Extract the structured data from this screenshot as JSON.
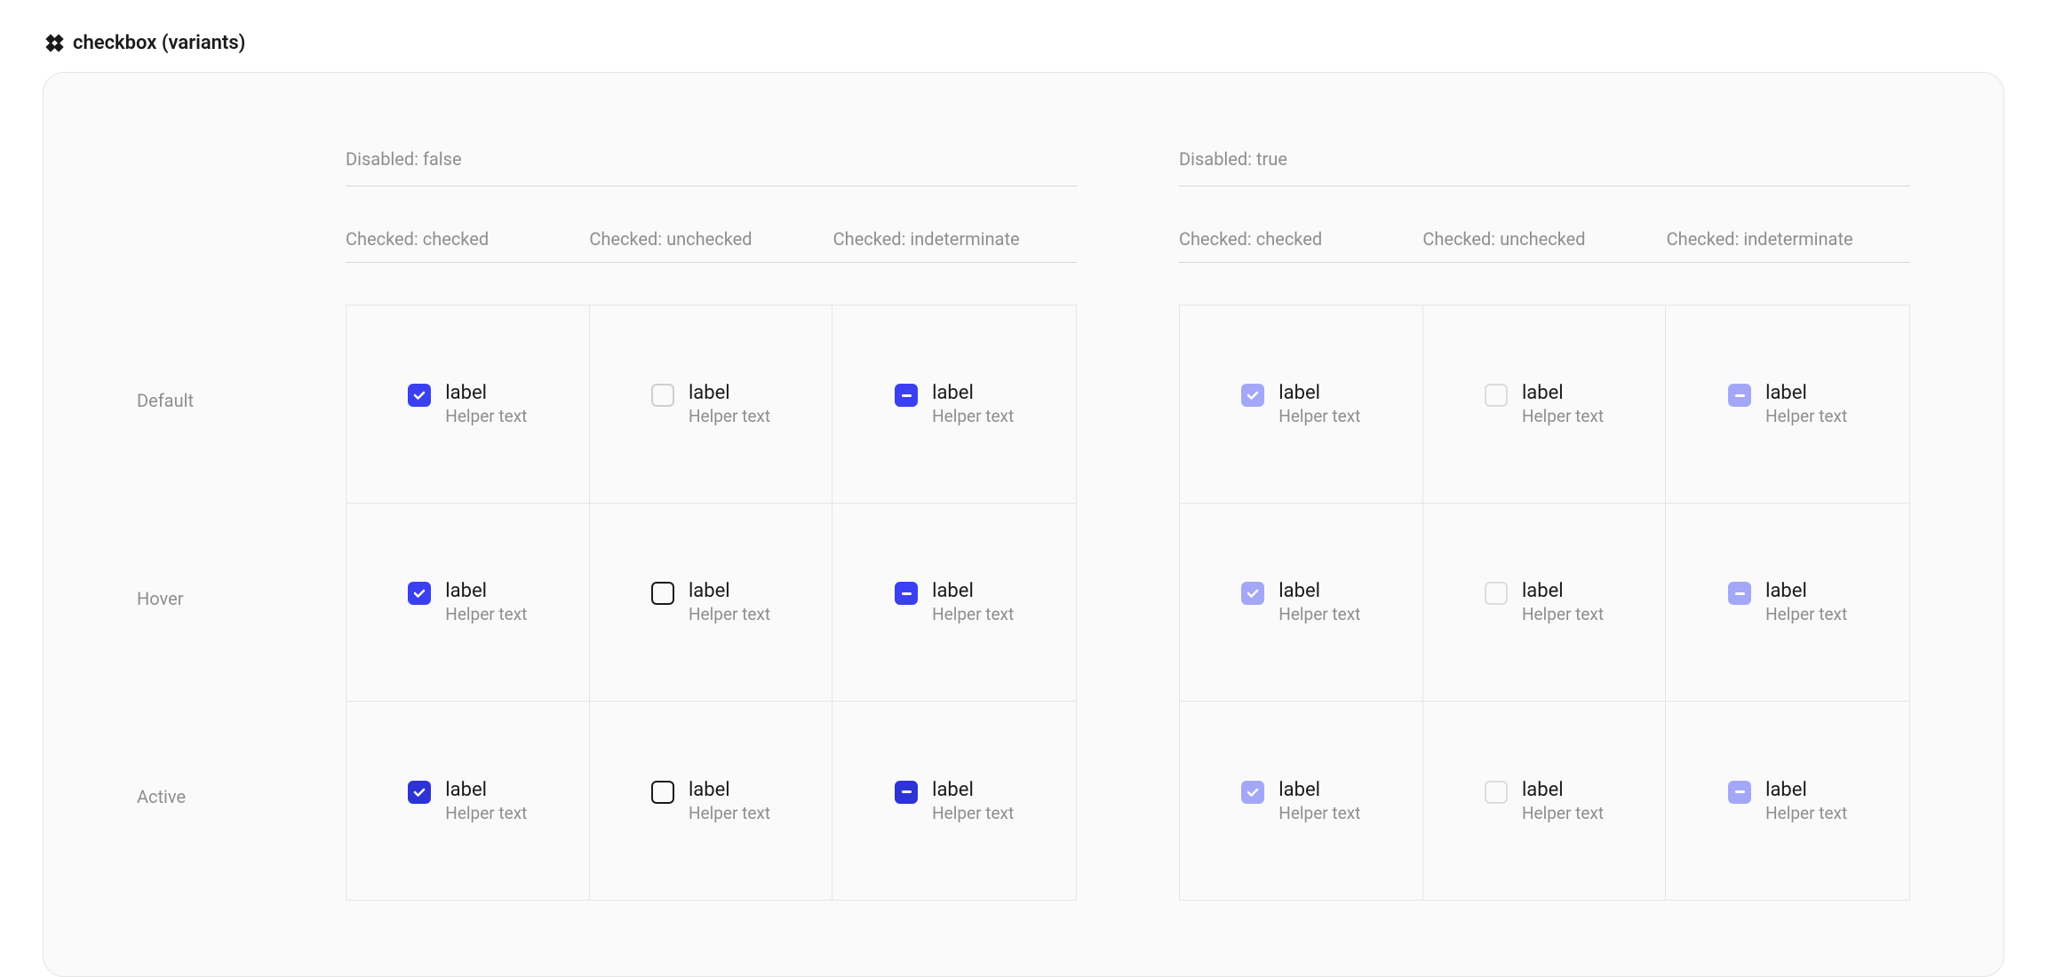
{
  "page_title": "checkbox (variants)",
  "disabled_groups": [
    {
      "label": "Disabled:  false",
      "disabled": false
    },
    {
      "label": "Disabled:  true",
      "disabled": true
    }
  ],
  "checked_columns": [
    {
      "label": "Checked:  checked",
      "kind": "checked"
    },
    {
      "label": "Checked:  unchecked",
      "kind": "unchecked"
    },
    {
      "label": "Checked:  indeterminate",
      "kind": "indeterminate"
    }
  ],
  "state_rows": [
    {
      "label": "Default",
      "state": "default"
    },
    {
      "label": "Hover",
      "state": "hover"
    },
    {
      "label": "Active",
      "state": "active"
    }
  ],
  "checkbox": {
    "label": "label",
    "helper": "Helper text"
  },
  "colors": {
    "primary": "#3b3ff2",
    "primary_active": "#2e33d4",
    "primary_disabled": "#a3a7f8",
    "border_default": "#cfcfcf",
    "border_hover": "#1a1a1a",
    "text": "#1a1a1a",
    "text_muted": "#8e8e8e"
  }
}
